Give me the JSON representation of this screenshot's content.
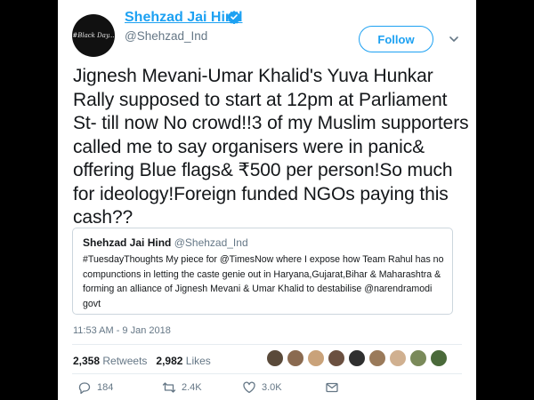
{
  "tweet": {
    "avatar_text": "#Black Day...",
    "display_name": "Shehzad Jai Hind",
    "handle": "@Shehzad_Ind",
    "follow_label": "Follow",
    "text": "Jignesh Mevani-Umar Khalid's Yuva Hunkar Rally supposed to start at 12pm at Parliament St- till now No crowd!!3 of my Muslim supporters called me to say organisers were in panic& offering Blue flags& ₹500 per person!So much for ideology!Foreign funded NGOs paying this cash??",
    "timestamp": "11:53 AM - 9 Jan 2018"
  },
  "quote": {
    "display_name": "Shehzad Jai Hind",
    "handle": "@Shehzad_Ind",
    "text": "#TuesdayThoughts My piece for @TimesNow where I expose how Team Rahul has no compunctions in letting the caste genie out in Haryana,Gujarat,Bihar & Maharashtra & forming an alliance of Jignesh Mevani & Umar Khalid to destabilise @narendramodi govt"
  },
  "stats": {
    "retweets_count": "2,358",
    "retweets_label": "Retweets",
    "likes_count": "2,982",
    "likes_label": "Likes"
  },
  "actions": {
    "reply_count": "184",
    "retweet_count": "2.4K",
    "like_count": "3.0K"
  },
  "colors": {
    "accent": "#1da1f2",
    "text": "#14171a",
    "muted": "#657786"
  }
}
